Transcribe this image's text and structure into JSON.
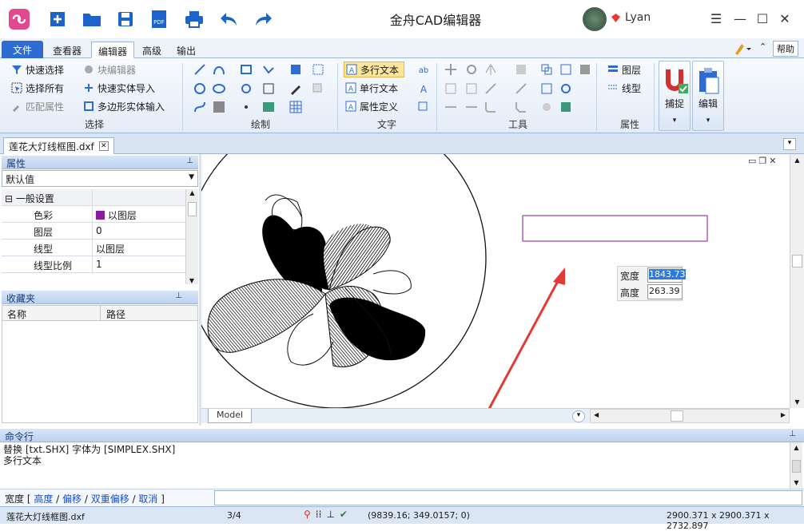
{
  "app": {
    "title": "金舟CAD编辑器",
    "user": "Lyan"
  },
  "menu": {
    "tabs": [
      "文件",
      "查看器",
      "编辑器",
      "高级",
      "输出"
    ],
    "active": "编辑器",
    "help": "帮助"
  },
  "ribbon": {
    "select": {
      "label": "选择",
      "items": [
        "快速选择",
        "选择所有",
        "匹配属性",
        "块编辑器",
        "快速实体导入",
        "多边形实体输入"
      ]
    },
    "draw": {
      "label": "绘制"
    },
    "text": {
      "label": "文字",
      "items": [
        "多行文本",
        "单行文本",
        "属性定义"
      ]
    },
    "tools": {
      "label": "工具"
    },
    "props": {
      "label": "属性",
      "items": [
        "图层",
        "线型"
      ]
    },
    "big": {
      "capture": "捕捉",
      "edit": "编辑"
    }
  },
  "document": {
    "tab": "莲花大灯线框图.dxf",
    "model_tab": "Model"
  },
  "properties": {
    "title": "属性",
    "dropdown": "默认值",
    "section": "一般设置",
    "rows": [
      {
        "key": "色彩",
        "value": "以图层"
      },
      {
        "key": "图层",
        "value": "0"
      },
      {
        "key": "线型",
        "value": "以图层"
      },
      {
        "key": "线型比例",
        "value": "1"
      }
    ]
  },
  "favorites": {
    "title": "收藏夹",
    "columns": [
      "名称",
      "路径"
    ]
  },
  "canvas_input": {
    "width_label": "宽度",
    "width_value": "1843.73",
    "height_label": "高度",
    "height_value": "263.39"
  },
  "command": {
    "title": "命令行",
    "lines": [
      "替换 [txt.SHX] 字体为 [SIMPLEX.SHX]",
      "多行文本"
    ],
    "prompt_prefix": "宽度 [",
    "options": [
      "高度",
      "偏移",
      "双重偏移",
      "取消"
    ],
    "prompt_suffix": "]"
  },
  "status": {
    "file": "莲花大灯线框图.dxf",
    "page": "3/4",
    "coords": "(9839.16; 349.0157; 0)",
    "extents": "2900.371 x 2900.371 x 2732.897"
  },
  "colors": {
    "accent": "#2e6bd2",
    "color_swatch": "#8b1a9e",
    "arrow": "#e53935",
    "rect": "#9b3aa8"
  }
}
